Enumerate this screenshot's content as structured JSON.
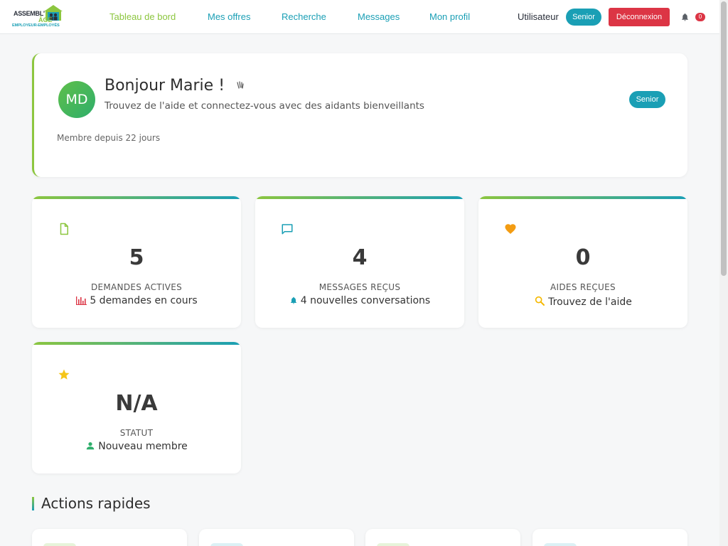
{
  "navbar": {
    "logo": {
      "line1": "ASSEMBL'",
      "line2": "ÂGE",
      "line3": "EMPLOYEUR-EMPLOYÉS"
    },
    "links": [
      {
        "label": "Tableau de bord",
        "active": true
      },
      {
        "label": "Mes offres",
        "active": false
      },
      {
        "label": "Recherche",
        "active": false
      },
      {
        "label": "Messages",
        "active": false
      },
      {
        "label": "Mon profil",
        "active": false
      }
    ],
    "user_label": "Utilisateur",
    "role_badge": "Senior",
    "logout_label": "Déconnexion",
    "notification_count": "0"
  },
  "welcome": {
    "avatar_initials": "MD",
    "greeting": "Bonjour Marie !",
    "subtitle": "Trouvez de l'aide et connectez-vous avec des aidants bienveillants",
    "member_since": "Membre depuis 22 jours",
    "role_badge": "Senior"
  },
  "stats": [
    {
      "icon": "document-icon",
      "value": "5",
      "label": "DEMANDES ACTIVES",
      "sub": "5 demandes en cours",
      "sub_icon": "bar-chart-icon"
    },
    {
      "icon": "message-icon",
      "value": "4",
      "label": "MESSAGES REÇUS",
      "sub": "4 nouvelles conversations",
      "sub_icon": "bell-icon"
    },
    {
      "icon": "heart-icon",
      "value": "0",
      "label": "AIDES REÇUES",
      "sub": "Trouvez de l'aide",
      "sub_icon": "search-icon"
    },
    {
      "icon": "star-icon",
      "value": "N/A",
      "label": "STATUT",
      "sub": "Nouveau membre",
      "sub_icon": "person-icon"
    }
  ],
  "quick_actions": {
    "title": "Actions rapides"
  },
  "colors": {
    "primary": "#1a9fb5",
    "accent_green": "#8cc63f",
    "danger": "#dc3545",
    "heart": "#f39c12",
    "star": "#f5c518"
  }
}
